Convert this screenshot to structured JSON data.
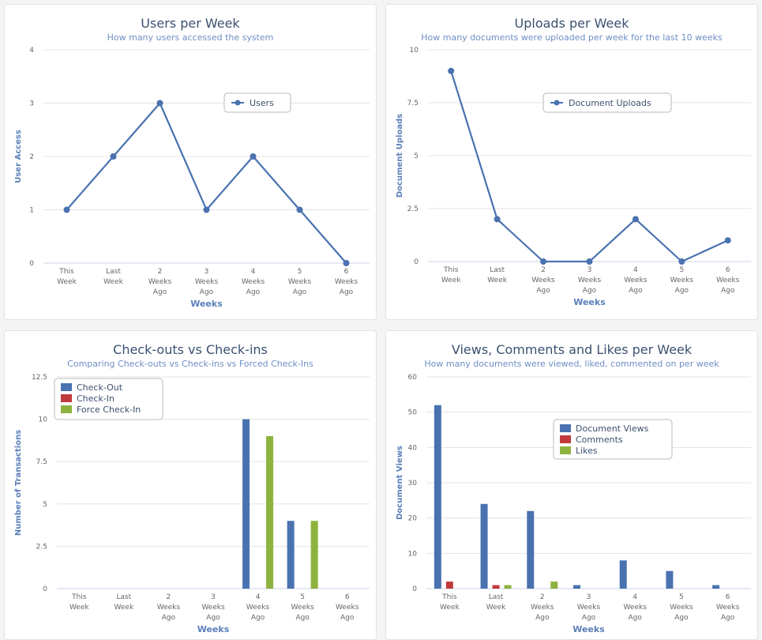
{
  "colors": {
    "blue": "#4a72b0",
    "red": "#c0393b",
    "green": "#8db33e",
    "grid": "#e3e3e3",
    "muted": "#666666"
  },
  "chart_data": [
    {
      "type": "line",
      "title": "Users per Week",
      "subtitle": "How many users accessed the system",
      "xlabel": "Weeks",
      "ylabel": "User Access",
      "categories": [
        [
          "This",
          "Week"
        ],
        [
          "Last",
          "Week"
        ],
        [
          "2",
          "Weeks",
          "Ago"
        ],
        [
          "3",
          "Weeks",
          "Ago"
        ],
        [
          "4",
          "Weeks",
          "Ago"
        ],
        [
          "5",
          "Weeks",
          "Ago"
        ],
        [
          "6",
          "Weeks",
          "Ago"
        ]
      ],
      "series": [
        {
          "name": "Users",
          "values": [
            1,
            2,
            3,
            1,
            2,
            1,
            0
          ]
        }
      ],
      "ylim": [
        0,
        4
      ],
      "yticks": [
        "0",
        "1",
        "2",
        "3",
        "4"
      ],
      "grid": true,
      "legend": "top-right"
    },
    {
      "type": "line",
      "title": "Uploads per Week",
      "subtitle": "How many documents were uploaded per week for the last 10 weeks",
      "xlabel": "Weeks",
      "ylabel": "Document Uploads",
      "categories": [
        [
          "This",
          "Week"
        ],
        [
          "Last",
          "Week"
        ],
        [
          "2",
          "Weeks",
          "Ago"
        ],
        [
          "3",
          "Weeks",
          "Ago"
        ],
        [
          "4",
          "Weeks",
          "Ago"
        ],
        [
          "5",
          "Weeks",
          "Ago"
        ],
        [
          "6",
          "Weeks",
          "Ago"
        ]
      ],
      "series": [
        {
          "name": "Document Uploads",
          "values": [
            9,
            2,
            0,
            0,
            2,
            0,
            1
          ]
        }
      ],
      "ylim": [
        0,
        10
      ],
      "yticks": [
        "0",
        "2.5",
        "5",
        "7.5",
        "10"
      ],
      "grid": true,
      "legend": "top-right"
    },
    {
      "type": "bar",
      "title": "Check-outs vs Check-ins",
      "subtitle": "Comparing Check-outs vs Check-ins vs Forced Check-Ins",
      "xlabel": "Weeks",
      "ylabel": "Number of Transactions",
      "categories": [
        [
          "This",
          "Week"
        ],
        [
          "Last",
          "Week"
        ],
        [
          "2",
          "Weeks",
          "Ago"
        ],
        [
          "3",
          "Weeks",
          "Ago"
        ],
        [
          "4",
          "Weeks",
          "Ago"
        ],
        [
          "5",
          "Weeks",
          "Ago"
        ],
        [
          "6",
          "Weeks",
          "Ago"
        ]
      ],
      "series": [
        {
          "name": "Check-Out",
          "values": [
            0,
            0,
            0,
            0,
            10,
            4,
            0
          ]
        },
        {
          "name": "Check-In",
          "values": [
            0,
            0,
            0,
            0,
            0,
            0,
            0
          ]
        },
        {
          "name": "Force Check-In",
          "values": [
            0,
            0,
            0,
            0,
            9,
            4,
            0
          ]
        }
      ],
      "ylim": [
        0,
        12.5
      ],
      "yticks": [
        "0",
        "2.5",
        "5",
        "7.5",
        "10",
        "12.5"
      ],
      "grid": true,
      "legend": "top-left"
    },
    {
      "type": "bar",
      "title": "Views, Comments and Likes per Week",
      "subtitle": "How many documents were viewed, liked, commented on per week",
      "xlabel": "Weeks",
      "ylabel": "Document Views",
      "categories": [
        [
          "This",
          "Week"
        ],
        [
          "Last",
          "Week"
        ],
        [
          "2",
          "Weeks",
          "Ago"
        ],
        [
          "3",
          "Weeks",
          "Ago"
        ],
        [
          "4",
          "Weeks",
          "Ago"
        ],
        [
          "5",
          "Weeks",
          "Ago"
        ],
        [
          "6",
          "Weeks",
          "Ago"
        ]
      ],
      "series": [
        {
          "name": "Document Views",
          "values": [
            52,
            24,
            22,
            1,
            8,
            5,
            1
          ]
        },
        {
          "name": "Comments",
          "values": [
            2,
            1,
            0,
            0,
            0,
            0,
            0
          ]
        },
        {
          "name": "Likes",
          "values": [
            0,
            1,
            2,
            0,
            0,
            0,
            0
          ]
        }
      ],
      "ylim": [
        0,
        60
      ],
      "yticks": [
        "0",
        "10",
        "20",
        "30",
        "40",
        "50",
        "60"
      ],
      "grid": true,
      "legend": "top-right"
    }
  ]
}
